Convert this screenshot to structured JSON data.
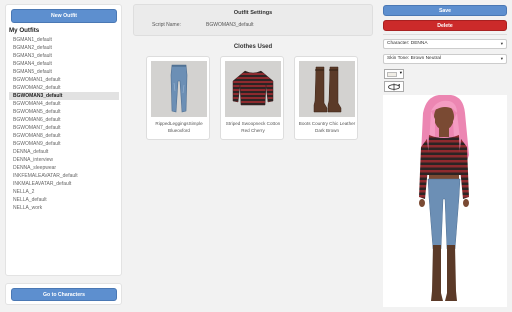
{
  "sidebar": {
    "new_outfit_label": "New Outfit",
    "title": "My Outfits",
    "outfits": [
      "BGMAN1_default",
      "BGMAN2_default",
      "BGMAN3_default",
      "BGMAN4_default",
      "BGMAN5_default",
      "BGWOMAN1_default",
      "BGWOMAN2_default",
      "BGWOMAN3_default",
      "BGWOMAN4_default",
      "BGWOMAN5_default",
      "BGWOMAN6_default",
      "BGWOMAN7_default",
      "BGWOMAN8_default",
      "BGWOMAN9_default",
      "DENNA_default",
      "DENNA_interview",
      "DENNA_sleepwear",
      "INKFEMALEAVATAR_default",
      "INKMALEAVATAR_default",
      "NELLA_2",
      "NELLA_default",
      "NELLA_work"
    ],
    "selected_index": 7,
    "go_to_characters_label": "Go to Characters"
  },
  "settings": {
    "title": "Outfit Settings",
    "script_name_label": "Script Name:",
    "script_name_value": "BGWOMAN3_default"
  },
  "clothes": {
    "title": "Clothes Used",
    "items": [
      {
        "name": "RippedLeggingsSimple Blueoxford",
        "icon": "jeans-icon"
      },
      {
        "name": "Striped Swoopneck Cotton Red Cherry",
        "icon": "sweater-icon"
      },
      {
        "name": "Boots Country Chic Leather Dark Brown",
        "icon": "boots-icon"
      }
    ]
  },
  "actions": {
    "save_label": "Save",
    "delete_label": "Delete"
  },
  "character_select": {
    "value": "Character: DENNA"
  },
  "skin_select": {
    "value": "Skin Tone: Brown Neutral"
  },
  "colors": {
    "primary": "#5d8fcf",
    "danger": "#cc2a2a",
    "jeans": "#6c8fb5",
    "sweater_red": "#8e2a2e",
    "sweater_dark": "#2c2424",
    "boots": "#5b3a28",
    "hair": "#f08fb8",
    "skin": "#7a4a33"
  }
}
